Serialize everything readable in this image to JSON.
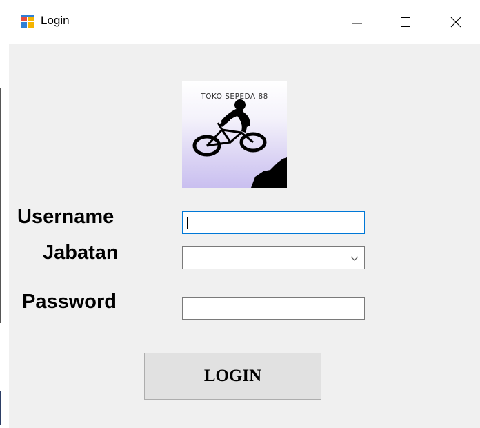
{
  "window": {
    "title": "Login",
    "app_icon": "windows-forms-app-icon",
    "controls": {
      "minimize_icon": "minimize-icon",
      "maximize_icon": "maximize-icon",
      "close_icon": "close-icon"
    }
  },
  "logo": {
    "text": "TOKO SEPEDA 88",
    "icon": "mountain-biker-icon"
  },
  "form": {
    "username_label": "Username",
    "username_value": "",
    "jabatan_label": "Jabatan",
    "jabatan_selected": "",
    "password_label": "Password",
    "password_value": ""
  },
  "login_button_label": "LOGIN",
  "colors": {
    "window_background": "#f0f0f0",
    "titlebar_background": "#ffffff",
    "focus_border": "#0078d7",
    "button_background": "#e1e1e1"
  }
}
